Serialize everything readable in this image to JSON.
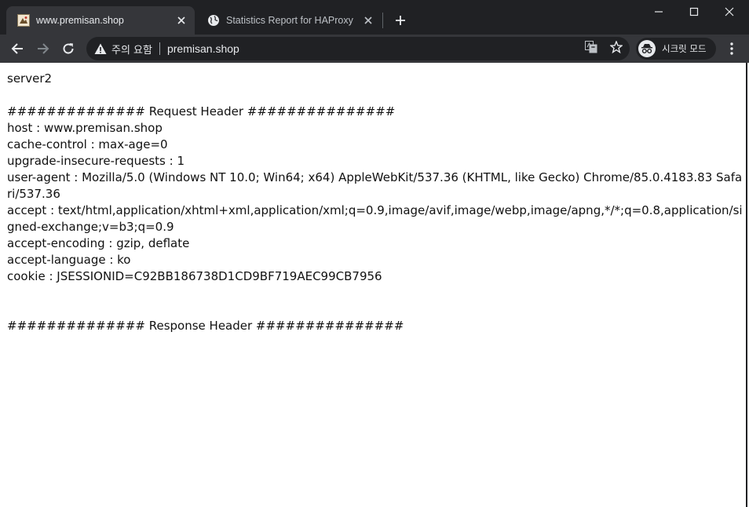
{
  "tabs": [
    {
      "title": "www.premisan.shop",
      "active": true,
      "favicon": "site-favicon"
    },
    {
      "title": "Statistics Report for HAProxy",
      "active": false,
      "favicon": "globe-icon"
    }
  ],
  "toolbar": {
    "security_label": "주의 요함",
    "url": "premisan.shop",
    "profile_label": "시크릿 모드"
  },
  "page": {
    "server": "server2",
    "request_header_title": "############## Request Header ###############",
    "request_headers": [
      "host : www.premisan.shop",
      "cache-control : max-age=0",
      "upgrade-insecure-requests : 1",
      "user-agent : Mozilla/5.0 (Windows NT 10.0; Win64; x64) AppleWebKit/537.36 (KHTML, like Gecko) Chrome/85.0.4183.83 Safari/537.36",
      "accept : text/html,application/xhtml+xml,application/xml;q=0.9,image/avif,image/webp,image/apng,*/*;q=0.8,application/signed-exchange;v=b3;q=0.9",
      "accept-encoding : gzip, deflate",
      "accept-language : ko",
      "cookie : JSESSIONID=C92BB186738D1CD9BF719AEC99CB7956"
    ],
    "response_header_title": "############## Response Header ###############"
  },
  "colors": {
    "titlebar": "#202124",
    "toolbar": "#35363a",
    "text": "#e8eaed"
  }
}
